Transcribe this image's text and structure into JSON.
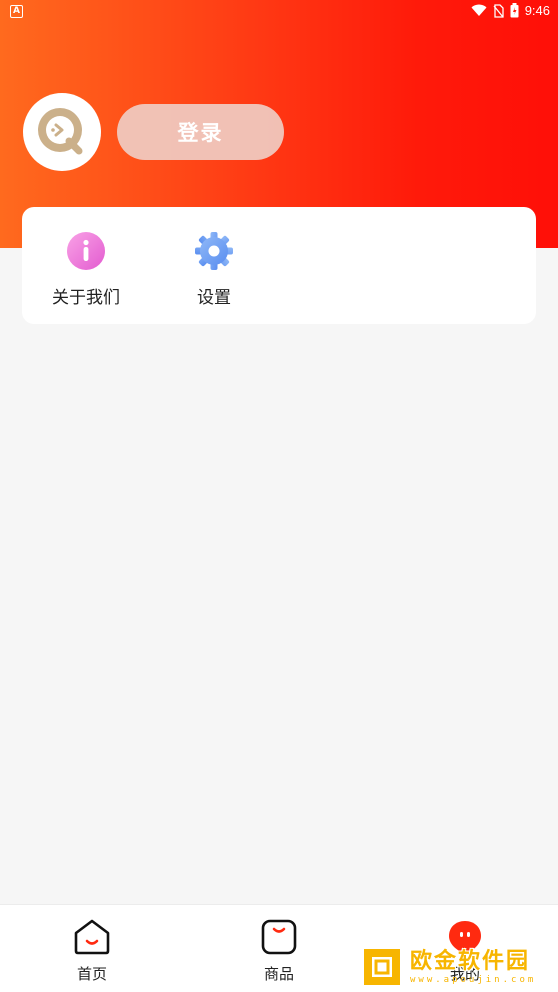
{
  "statusbar": {
    "time": "9:46",
    "notification_letter": "A"
  },
  "profile": {
    "login_label": "登录"
  },
  "menu": {
    "items": [
      {
        "label": "关于我们",
        "icon": "info-icon"
      },
      {
        "label": "设置",
        "icon": "gear-icon"
      }
    ]
  },
  "tabbar": {
    "tabs": [
      {
        "label": "首页",
        "icon": "home-icon"
      },
      {
        "label": "商品",
        "icon": "shopping-bag-icon"
      },
      {
        "label": "我的",
        "icon": "profile-face-icon"
      }
    ]
  },
  "watermark": {
    "title": "欧金软件园",
    "url": "www.apoujin.com"
  },
  "colors": {
    "accent": "#ff2a10",
    "header_start": "#ff6a1e",
    "header_end": "#ff0f08"
  }
}
